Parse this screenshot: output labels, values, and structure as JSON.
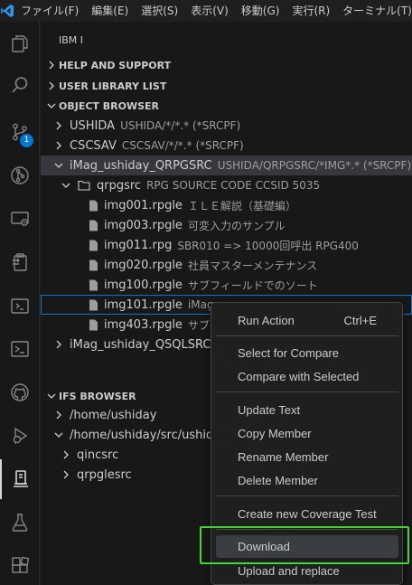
{
  "menubar": {
    "items": [
      "ファイル(F)",
      "編集(E)",
      "選択(S)",
      "表示(V)",
      "移動(G)",
      "実行(R)",
      "ターミナル(T)"
    ]
  },
  "activitybar": {
    "icons": [
      "explorer-icon",
      "search-icon",
      "source-control-icon",
      "git-graph-icon",
      "remote-explorer-icon",
      "clipboard-icon",
      "terminal-box-icon",
      "terminal-icon",
      "github-icon",
      "debug-icon",
      "ibmi-icon",
      "testing-icon",
      "extensions-icon"
    ],
    "scm_badge": "1"
  },
  "sidebar": {
    "title": "IBM I",
    "help_section": "HELP AND SUPPORT",
    "library_section": "USER LIBRARY LIST",
    "object_section": "OBJECT BROWSER",
    "filters": [
      {
        "label": "USHIDA",
        "desc": "USHIDA/*/*.* (*SRCPF)"
      },
      {
        "label": "CSCSAV",
        "desc": "CSCSAV/*/*.* (*SRCPF)"
      },
      {
        "label": "iMag_ushiday_QRPGSRC",
        "desc": "USHIDA/QRPGSRC/*IMG*.* (*SRCPF)"
      }
    ],
    "srcpf": {
      "label": "qrpgsrc",
      "desc": "RPG SOURCE CODE CCSID 5035"
    },
    "members": [
      {
        "label": "img001.rpgle",
        "desc": "ＩＬＥ解説（基礎編）"
      },
      {
        "label": "img003.rpgle",
        "desc": "可変入力のサンプル"
      },
      {
        "label": "img011.rpg",
        "desc": "SBR010 => 10000回呼出  RPG400"
      },
      {
        "label": "img020.rpgle",
        "desc": "社員マスターメンテナンス"
      },
      {
        "label": "img100.rpgle",
        "desc": "サブフィールドでのソート"
      },
      {
        "label": "img101.rpgle",
        "desc": "iMag"
      },
      {
        "label": "img403.rpgle",
        "desc": "サブフィー"
      }
    ],
    "filter_sql": {
      "label": "iMag_ushiday_QSQLSRC",
      "desc": "US"
    },
    "ifs_section": "IFS BROWSER",
    "ifs_items": [
      {
        "label": "/home/ushiday"
      },
      {
        "label": "/home/ushiday/src/ushiday"
      },
      {
        "label": "qincsrc"
      },
      {
        "label": "qrpglesrc"
      }
    ]
  },
  "context_menu": {
    "run_action": "Run Action",
    "run_action_key": "Ctrl+E",
    "select_compare": "Select for Compare",
    "compare_selected": "Compare with Selected",
    "update_text": "Update Text",
    "copy_member": "Copy Member",
    "rename_member": "Rename Member",
    "delete_member": "Delete Member",
    "coverage_test": "Create new Coverage Test",
    "download": "Download",
    "upload_replace": "Upload and replace"
  },
  "colors": {
    "accent": "#0078d4",
    "highlight_box": "#3ddc2c",
    "sidebar_bg": "#181818"
  }
}
